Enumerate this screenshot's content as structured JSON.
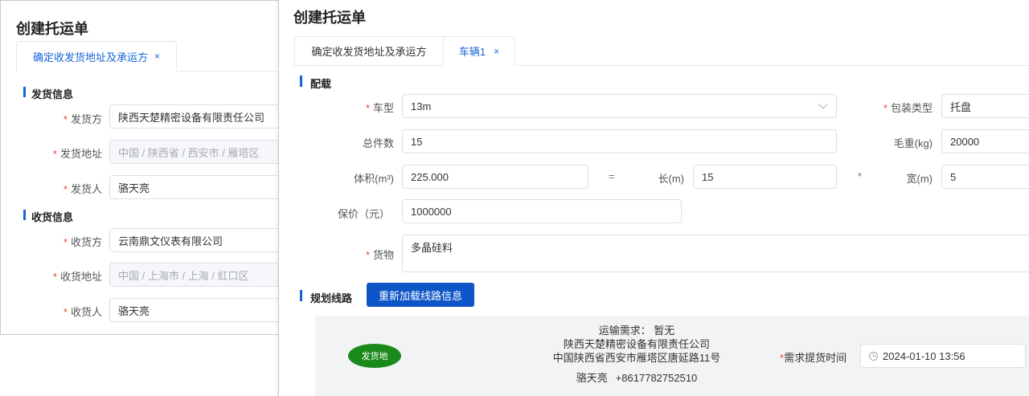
{
  "left": {
    "title": "创建托运单",
    "tab": {
      "label": "确定收发货地址及承运方",
      "close": "×"
    },
    "shipper_section": "发货信息",
    "shipper": [
      {
        "label": "发货方",
        "value": "陕西天楚精密设备有限责任公司",
        "disabled": false
      },
      {
        "label": "发货地址",
        "value": "中国 / 陕西省 / 西安市 / 雁塔区",
        "disabled": true
      },
      {
        "label": "发货人",
        "value": "骆天亮",
        "disabled": false
      }
    ],
    "receiver_section": "收货信息",
    "receiver": [
      {
        "label": "收货方",
        "value": "云南鼎文仪表有限公司",
        "disabled": false
      },
      {
        "label": "收货地址",
        "value": "中国 / 上海市 / 上海 / 虹口区",
        "disabled": true
      },
      {
        "label": "收货人",
        "value": "骆天亮",
        "disabled": false
      }
    ],
    "required_mark": "*"
  },
  "right": {
    "title": "创建托运单",
    "tabs": [
      {
        "label": "确定收发货地址及承运方"
      },
      {
        "label": "车辆1",
        "close": "×"
      }
    ],
    "load_section": "配载",
    "vehicle_type": {
      "label": "车型",
      "value": "13m"
    },
    "package_type": {
      "label": "包装类型",
      "value": "托盘"
    },
    "total_pieces": {
      "label": "总件数",
      "value": "15"
    },
    "gross_weight": {
      "label": "毛重(kg)",
      "value": "20000"
    },
    "volume": {
      "label": "体积(m³)",
      "value": "225.000"
    },
    "equals": "=",
    "length": {
      "label": "长(m)",
      "value": "15"
    },
    "times": "*",
    "width": {
      "label": "宽(m)",
      "value": "5"
    },
    "insured_value": {
      "label": "保价（元）",
      "value": "1000000"
    },
    "goods": {
      "label": "货物",
      "value": "多晶硅料"
    },
    "route_section": "规划线路",
    "reload_button": "重新加载线路信息",
    "route": {
      "badge": "发货地",
      "requirement": "运输需求：   暂无",
      "company": "陕西天楚精密设备有限责任公司",
      "address": "中国陕西省西安市雁塔区唐延路11号",
      "contact_name": "骆天亮",
      "contact_phone": "+8617782752510",
      "pickup_label": "需求提货时间",
      "pickup_time": "2024-01-10 13:56"
    }
  }
}
